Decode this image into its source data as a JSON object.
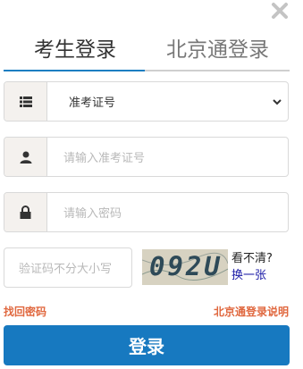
{
  "close_icon": "close-icon",
  "tabs": [
    {
      "label": "考生登录",
      "active": true
    },
    {
      "label": "北京通登录",
      "active": false
    }
  ],
  "form": {
    "id_type": {
      "icon": "list-icon",
      "selected": "准考证号"
    },
    "exam_id": {
      "icon": "user-icon",
      "placeholder": "请输入准考证号"
    },
    "password": {
      "icon": "lock-icon",
      "placeholder": "请输入密码"
    },
    "captcha": {
      "placeholder": "验证码不分大小写",
      "image_text": "092U"
    }
  },
  "captcha_hint": {
    "question": "看不清?",
    "refresh": "换一张"
  },
  "links": {
    "forgot": "找回密码",
    "explain": "北京通登录说明"
  },
  "login_button": "登录",
  "colors": {
    "accent": "#1779c0",
    "link_orange": "#e0683f",
    "addon_bg": "#f4f1ee"
  }
}
